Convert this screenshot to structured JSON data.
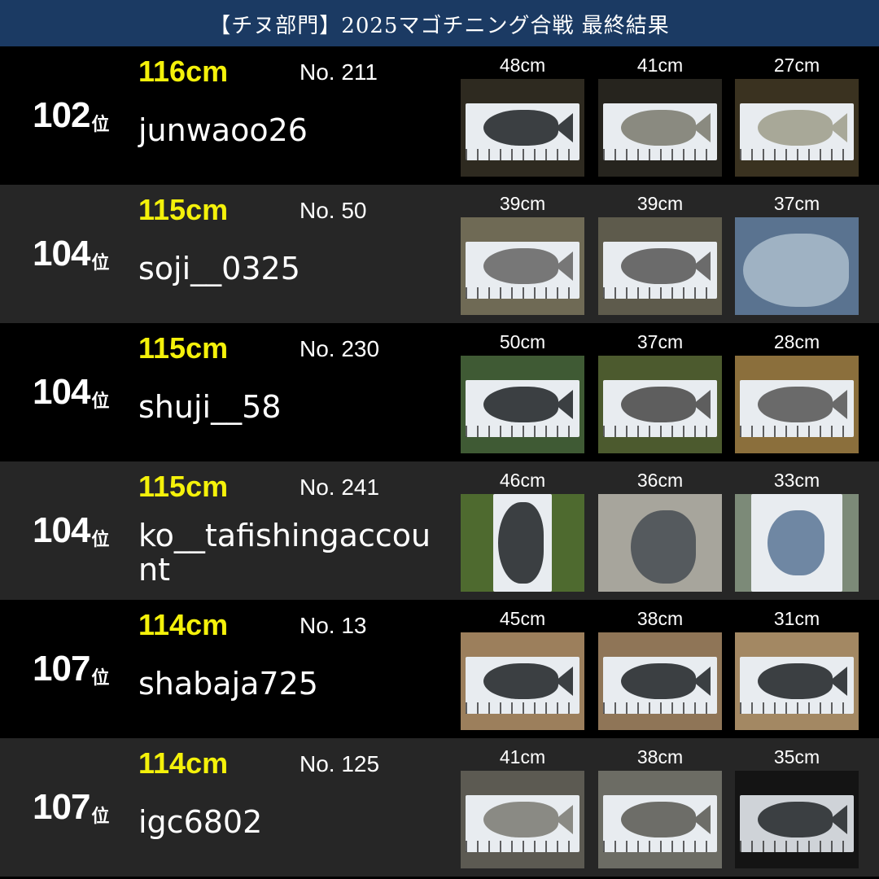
{
  "title": "【チヌ部門】2025マゴチニング合戦 最終結果",
  "rank_suffix": "位",
  "rows": [
    {
      "rank": "102",
      "total": "116cm",
      "no": "No. 211",
      "handle": "junwaoo26",
      "catches": [
        {
          "len": "48cm"
        },
        {
          "len": "41cm"
        },
        {
          "len": "27cm"
        }
      ]
    },
    {
      "rank": "104",
      "total": "115cm",
      "no": "No. 50",
      "handle": "soji__0325",
      "catches": [
        {
          "len": "39cm"
        },
        {
          "len": "39cm"
        },
        {
          "len": "37cm"
        }
      ]
    },
    {
      "rank": "104",
      "total": "115cm",
      "no": "No. 230",
      "handle": "shuji__58",
      "catches": [
        {
          "len": "50cm"
        },
        {
          "len": "37cm"
        },
        {
          "len": "28cm"
        }
      ]
    },
    {
      "rank": "104",
      "total": "115cm",
      "no": "No. 241",
      "handle": "ko__tafishingaccount",
      "catches": [
        {
          "len": "46cm"
        },
        {
          "len": "36cm"
        },
        {
          "len": "33cm"
        }
      ]
    },
    {
      "rank": "107",
      "total": "114cm",
      "no": "No. 13",
      "handle": "shabaja725",
      "catches": [
        {
          "len": "45cm"
        },
        {
          "len": "38cm"
        },
        {
          "len": "31cm"
        }
      ]
    },
    {
      "rank": "107",
      "total": "114cm",
      "no": "No. 125",
      "handle": "igc6802",
      "catches": [
        {
          "len": "41cm"
        },
        {
          "len": "38cm"
        },
        {
          "len": "35cm"
        }
      ]
    }
  ],
  "colors": {
    "header_bg": "#1b3a63",
    "row_dark": "#000000",
    "row_gray": "#262626",
    "total_yellow": "#f4f10a"
  }
}
